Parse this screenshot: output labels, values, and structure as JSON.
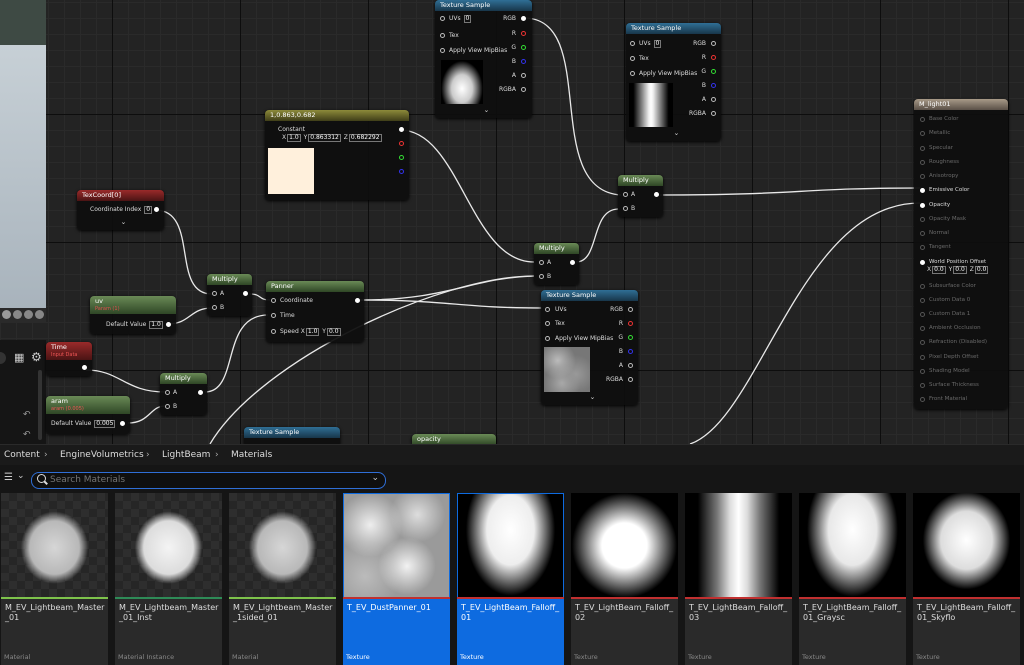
{
  "graph": {
    "nodes": {
      "texsample1": {
        "title": "Texture Sample",
        "uvs_label": "UVs",
        "uvs_value": "0",
        "tex_label": "Tex",
        "mip_label": "Apply View MipBias",
        "out_rgb": "RGB",
        "out_r": "R",
        "out_g": "G",
        "out_b": "B",
        "out_a": "A",
        "out_rgba": "RGBA"
      },
      "texsample2": {
        "title": "Texture Sample",
        "uvs_label": "UVs",
        "uvs_value": "0",
        "tex_label": "Tex",
        "mip_label": "Apply View MipBias",
        "out_rgb": "RGB",
        "out_r": "R",
        "out_g": "G",
        "out_b": "B",
        "out_a": "A",
        "out_rgba": "RGBA"
      },
      "texsample3": {
        "title": "Texture Sample",
        "uvs_label": "UVs",
        "tex_label": "Tex",
        "mip_label": "Apply View MipBias",
        "out_rgb": "RGB",
        "out_r": "R",
        "out_g": "G",
        "out_b": "B",
        "out_a": "A",
        "out_rgba": "RGBA"
      },
      "texsample4": {
        "title": "Texture Sample"
      },
      "constant": {
        "title": "1,0.863,0.682",
        "label": "Constant",
        "x": "1.0",
        "y": "0.863312",
        "z": "0.682292",
        "swatch": "#fff0dc"
      },
      "texcoord": {
        "title": "TexCoord[0]",
        "label": "Coordinate Index",
        "value": "0"
      },
      "multiply1": {
        "title": "Multiply",
        "a": "A",
        "b": "B"
      },
      "multiply2": {
        "title": "Multiply",
        "a": "A",
        "b": "B"
      },
      "multiply3": {
        "title": "Multiply",
        "a": "A",
        "b": "B"
      },
      "multiply4": {
        "title": "Multiply",
        "a": "A",
        "b": "B"
      },
      "panner": {
        "title": "Panner",
        "coord": "Coordinate",
        "time": "Time",
        "speed": "Speed",
        "sx": "1.0",
        "sy": "0.0"
      },
      "uvparam": {
        "title": "uv",
        "subtitle": "Param (1)",
        "label": "Default Value",
        "value": "1.0"
      },
      "time": {
        "title": "Time",
        "subtitle": "Input Data"
      },
      "param": {
        "title": "aram",
        "subtitle": "aram (0.005)",
        "label": "Default Value",
        "value": "0.005"
      },
      "opacity": {
        "title": "opacity"
      },
      "material": {
        "title": "M_light01",
        "inputs": [
          "Base Color",
          "Metallic",
          "Specular",
          "Roughness",
          "Anisotropy",
          "Emissive Color",
          "Opacity",
          "Opacity Mask",
          "Normal",
          "Tangent",
          "World Position Offset",
          "Subsurface Color",
          "Custom Data 0",
          "Custom Data 1",
          "Ambient Occlusion",
          "Refraction (Disabled)",
          "Pixel Depth Offset",
          "Shading Model",
          "Surface Thickness",
          "Front Material"
        ],
        "wpo_x": "0.0",
        "wpo_y": "0.0",
        "wpo_z": "0.0"
      }
    }
  },
  "content_browser": {
    "breadcrumbs": [
      "Content",
      "EngineVolumetrics",
      "LightBeam",
      "Materials"
    ],
    "search_placeholder": "Search Materials",
    "assets": [
      {
        "name": "M_EV_Lightbeam_Master_01",
        "type": "Material",
        "bar": "#7ec34b",
        "thumb": "sphere",
        "selected": false
      },
      {
        "name": "M_EV_Lightbeam_Master_01_Inst",
        "type": "Material Instance",
        "bar": "#2e8b57",
        "thumb": "sphere-bright",
        "selected": false
      },
      {
        "name": "M_EV_Lightbeam_Master_1sided_01",
        "type": "Material",
        "bar": "#7ec34b",
        "thumb": "sphere",
        "selected": false
      },
      {
        "name": "T_EV_DustPanner_01",
        "type": "Texture",
        "bar": "#c03030",
        "thumb": "noise",
        "selected": true
      },
      {
        "name": "T_EV_LightBeam_Falloff_01",
        "type": "Texture",
        "bar": "#c03030",
        "thumb": "falloff",
        "selected": true
      },
      {
        "name": "T_EV_LightBeam_Falloff_02",
        "type": "Texture",
        "bar": "#c03030",
        "thumb": "circle",
        "selected": false
      },
      {
        "name": "T_EV_LightBeam_Falloff_03",
        "type": "Texture",
        "bar": "#c03030",
        "thumb": "streaks",
        "selected": false
      },
      {
        "name": "T_EV_LightBeam_Falloff_01_Graysc",
        "type": "Texture",
        "bar": "#c03030",
        "thumb": "falloff-soft",
        "selected": false
      },
      {
        "name": "T_EV_LightBeam_Falloff_01_Skyflo",
        "type": "Texture",
        "bar": "#c03030",
        "thumb": "falloff-square",
        "selected": false
      }
    ]
  }
}
